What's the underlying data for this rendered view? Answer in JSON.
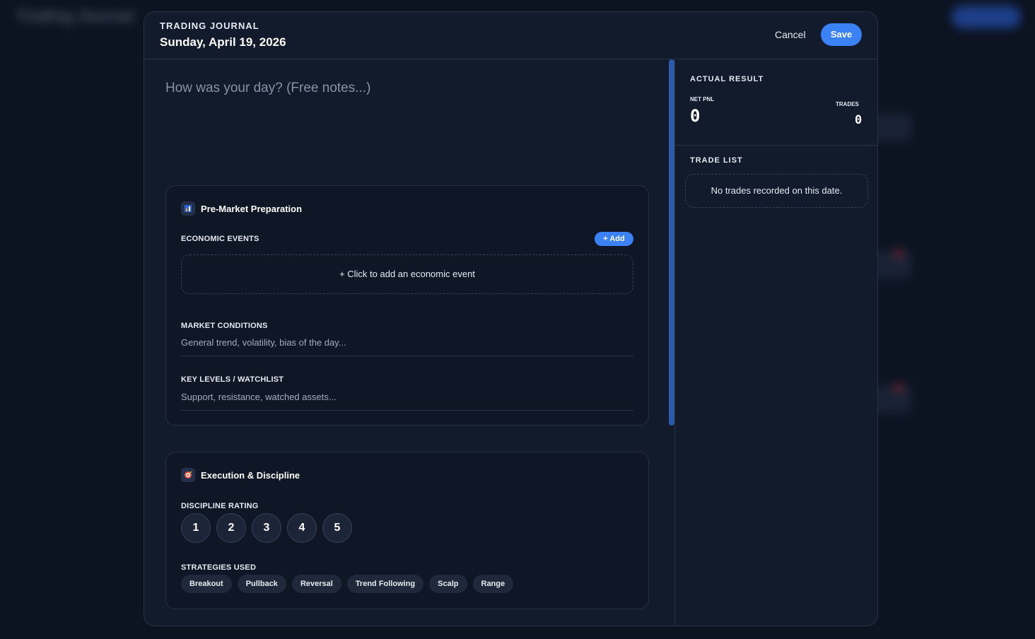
{
  "backdrop": {
    "title": "Trading Journal"
  },
  "header": {
    "kicker": "TRADING JOURNAL",
    "date": "Sunday, April 19, 2026",
    "cancel_label": "Cancel",
    "save_label": "Save"
  },
  "notes": {
    "placeholder": "How was your day? (Free notes...)"
  },
  "premarket": {
    "icon": "chart-icon",
    "title": "Pre-Market Preparation",
    "economic_events_label": "ECONOMIC EVENTS",
    "add_label": "+ Add",
    "add_event_prompt": "+ Click to add an economic event",
    "market_conditions_label": "MARKET CONDITIONS",
    "market_conditions_placeholder": "General trend, volatility, bias of the day...",
    "key_levels_label": "KEY LEVELS / WATCHLIST",
    "key_levels_placeholder": "Support, resistance, watched assets..."
  },
  "execution": {
    "icon": "target-icon",
    "title": "Execution & Discipline",
    "discipline_label": "DISCIPLINE RATING",
    "ratings": [
      "1",
      "2",
      "3",
      "4",
      "5"
    ],
    "strategies_label": "STRATEGIES USED",
    "strategies": [
      "Breakout",
      "Pullback",
      "Reversal",
      "Trend Following",
      "Scalp",
      "Range"
    ]
  },
  "result": {
    "title": "ACTUAL RESULT",
    "net_pnl_label": "NET PNL",
    "net_pnl_value": "0",
    "trades_label": "TRADES",
    "trades_value": "0"
  },
  "trade_list": {
    "title": "TRADE LIST",
    "empty_message": "No trades recorded on this date."
  },
  "colors": {
    "accent": "#3b82f6",
    "background": "#0c1321",
    "panel": "#121b2b"
  }
}
